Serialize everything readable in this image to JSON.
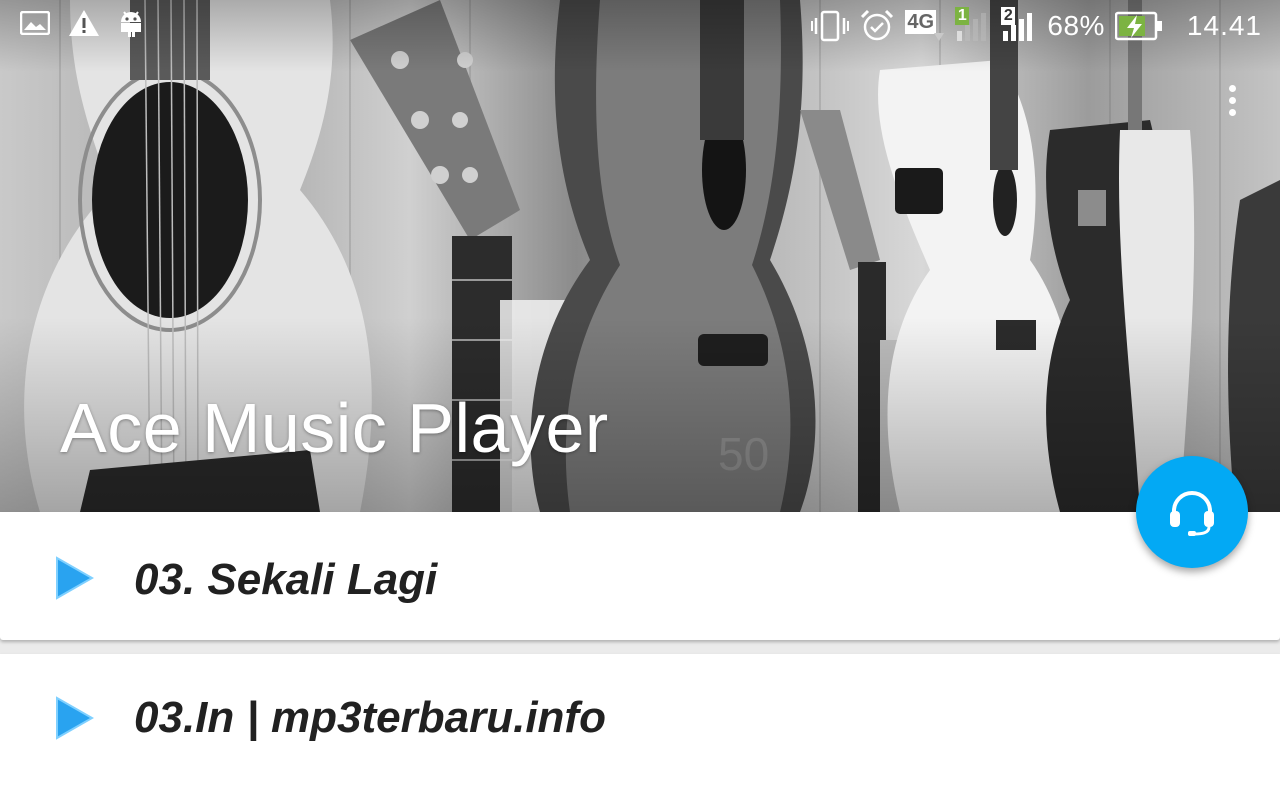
{
  "status_bar": {
    "battery_percent": "68%",
    "time": "14.41",
    "network_type": "4G",
    "sim1_label": "1",
    "sim2_label": "2",
    "icons_left": [
      "image-icon",
      "warning-icon",
      "android-icon"
    ],
    "icons_right": [
      "vibrate-icon",
      "alarm-icon",
      "network-4g-icon",
      "signal-sim1-icon",
      "signal-sim2-icon",
      "battery-charging-icon"
    ]
  },
  "header": {
    "app_title": "Ace Music Player",
    "background": "guitars-photo",
    "menu_icon": "more-vert-icon"
  },
  "songs": [
    {
      "title": "03. Sekali Lagi",
      "icon": "play-icon"
    },
    {
      "title": "03.In | mp3terbaru.info",
      "icon": "play-icon"
    }
  ],
  "fab": {
    "icon": "headphones-icon",
    "color": "#03a9f4"
  },
  "colors": {
    "accent": "#03a9f4",
    "play_icon": "#2196f3"
  }
}
